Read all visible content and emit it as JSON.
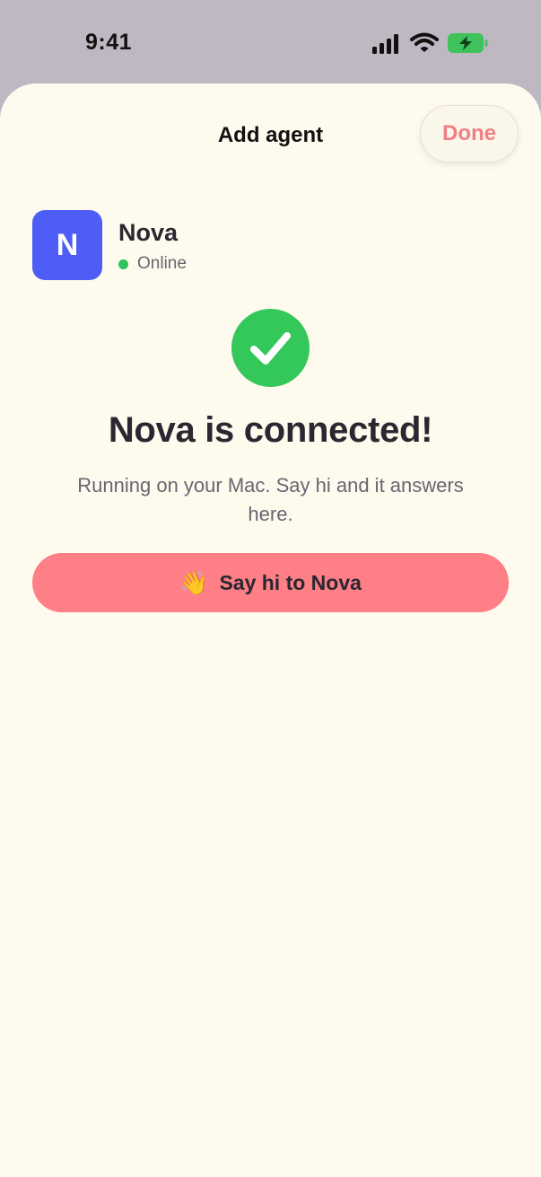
{
  "status_bar": {
    "time": "9:41",
    "icons": [
      "signal-icon",
      "wifi-icon",
      "battery-charging-icon"
    ]
  },
  "sheet": {
    "title": "Add agent",
    "done_label": "Done"
  },
  "agent": {
    "initial": "N",
    "name": "Nova",
    "status": "Online",
    "avatar_color": "#4e5df5",
    "status_color": "#30c158"
  },
  "confirmation": {
    "icon": "checkmark-circle-icon",
    "headline": "Nova is connected!",
    "subtext": "Running on your Mac. Say hi and it answers here."
  },
  "cta": {
    "icon": "waving-hand-icon",
    "label": "Say hi to Nova"
  },
  "colors": {
    "accent": "#fe7f86",
    "done_text": "#f07f84",
    "success": "#34c759",
    "sheet_background": "#fefaee"
  }
}
